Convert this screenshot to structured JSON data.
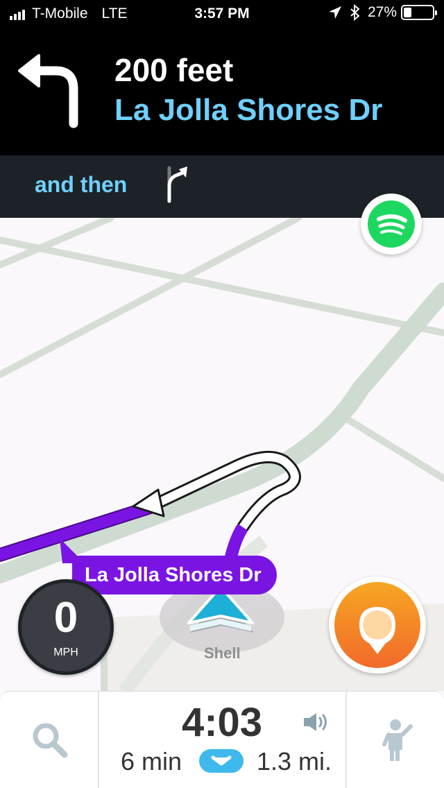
{
  "status_bar": {
    "carrier": "T-Mobile",
    "network": "LTE",
    "time": "3:57 PM",
    "battery": "27%",
    "battery_level": 0.27,
    "icons": [
      "signal-icon",
      "location-arrow-icon",
      "bluetooth-icon",
      "battery-icon"
    ]
  },
  "navigation": {
    "distance": "200 feet",
    "street": "La Jolla Shores Dr",
    "maneuver_icon": "turn-left-icon",
    "then_label": "and then",
    "then_icon": "turn-right-icon"
  },
  "map": {
    "street_label": "La Jolla Shores Dr",
    "poi_label": "Shell",
    "speed": "0",
    "speed_unit": "MPH",
    "route_color": "#7a14e2",
    "accent_color": "#6fd0fb"
  },
  "buttons": {
    "spotify_icon": "spotify-icon",
    "report_icon": "report-pin-icon",
    "search_icon": "search-icon",
    "people_icon": "person-wave-icon"
  },
  "eta": {
    "arrival_time": "4:03",
    "duration": "6 min",
    "distance": "1.3 mi.",
    "sound_icon": "speaker-icon",
    "expand_icon": "chevron-down-icon"
  }
}
